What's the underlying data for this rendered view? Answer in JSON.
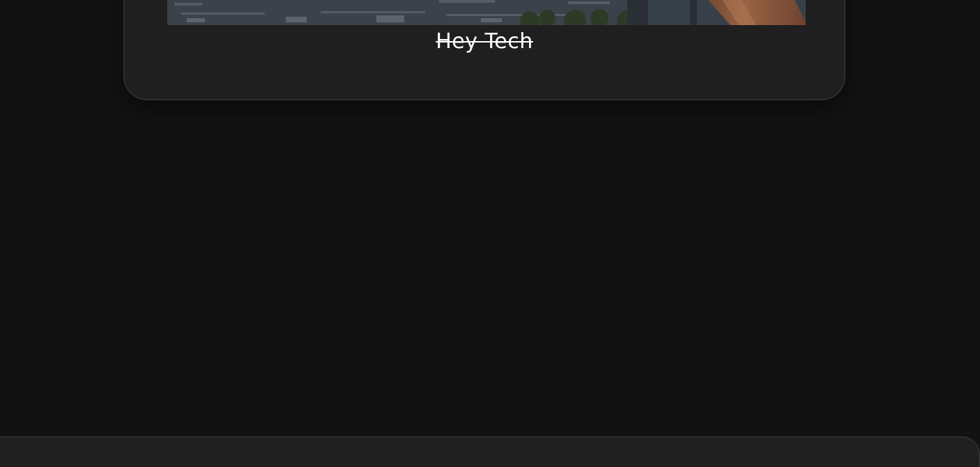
{
  "card": {
    "title": "Hey Tech",
    "image_alt": "city-rooftops-with-arm-photo"
  }
}
